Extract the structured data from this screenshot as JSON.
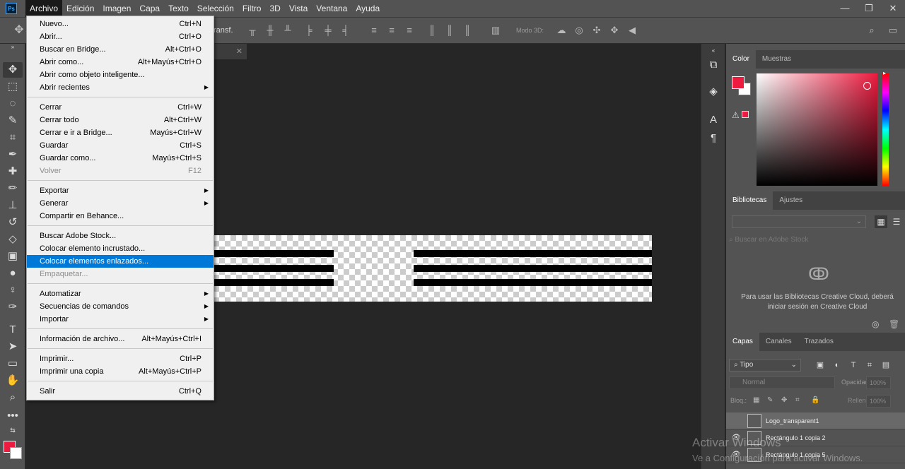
{
  "app": {
    "logo": "Ps",
    "window_controls": [
      "—",
      "❐",
      "✕"
    ]
  },
  "menubar": [
    "Archivo",
    "Edición",
    "Imagen",
    "Capa",
    "Texto",
    "Selección",
    "Filtro",
    "3D",
    "Vista",
    "Ventana",
    "Ayuda"
  ],
  "options_bar": {
    "transform_label": "ransf.",
    "mode_3d_label": "Modo 3D:"
  },
  "file_menu": [
    {
      "label": "Nuevo...",
      "shortcut": "Ctrl+N"
    },
    {
      "label": "Abrir...",
      "shortcut": "Ctrl+O"
    },
    {
      "label": "Buscar en Bridge...",
      "shortcut": "Alt+Ctrl+O"
    },
    {
      "label": "Abrir como...",
      "shortcut": "Alt+Mayús+Ctrl+O"
    },
    {
      "label": "Abrir como objeto inteligente...",
      "shortcut": ""
    },
    {
      "label": "Abrir recientes",
      "shortcut": "",
      "submenu": true
    },
    {
      "sep": true
    },
    {
      "label": "Cerrar",
      "shortcut": "Ctrl+W"
    },
    {
      "label": "Cerrar todo",
      "shortcut": "Alt+Ctrl+W"
    },
    {
      "label": "Cerrar e ir a Bridge...",
      "shortcut": "Mayús+Ctrl+W"
    },
    {
      "label": "Guardar",
      "shortcut": "Ctrl+S"
    },
    {
      "label": "Guardar como...",
      "shortcut": "Mayús+Ctrl+S"
    },
    {
      "label": "Volver",
      "shortcut": "F12",
      "disabled": true
    },
    {
      "sep": true
    },
    {
      "label": "Exportar",
      "shortcut": "",
      "submenu": true
    },
    {
      "label": "Generar",
      "shortcut": "",
      "submenu": true
    },
    {
      "label": "Compartir en Behance...",
      "shortcut": ""
    },
    {
      "sep": true
    },
    {
      "label": "Buscar Adobe Stock...",
      "shortcut": ""
    },
    {
      "label": "Colocar elemento incrustado...",
      "shortcut": ""
    },
    {
      "label": "Colocar elementos enlazados...",
      "shortcut": "",
      "highlighted": true
    },
    {
      "label": "Empaquetar...",
      "shortcut": "",
      "disabled": true
    },
    {
      "sep": true
    },
    {
      "label": "Automatizar",
      "shortcut": "",
      "submenu": true
    },
    {
      "label": "Secuencias de comandos",
      "shortcut": "",
      "submenu": true
    },
    {
      "label": "Importar",
      "shortcut": "",
      "submenu": true
    },
    {
      "sep": true
    },
    {
      "label": "Información de archivo...",
      "shortcut": "Alt+Mayús+Ctrl+I"
    },
    {
      "sep": true
    },
    {
      "label": "Imprimir...",
      "shortcut": "Ctrl+P"
    },
    {
      "label": "Imprimir una copia",
      "shortcut": "Alt+Mayús+Ctrl+P"
    },
    {
      "sep": true
    },
    {
      "label": "Salir",
      "shortcut": "Ctrl+Q"
    }
  ],
  "panels": {
    "color_tabs": [
      "Color",
      "Muestras"
    ],
    "library_tabs": [
      "Bibliotecas",
      "Ajustes"
    ],
    "library_search_placeholder": "Buscar en Adobe Stock",
    "library_message": "Para usar las Bibliotecas Creative Cloud, deberá iniciar sesión en Creative Cloud",
    "layers_tabs": [
      "Capas",
      "Canales",
      "Trazados"
    ],
    "layers_kind": "Tipo",
    "blend_mode": "Normal",
    "opacity_label": "Opacidad:",
    "opacity_value": "100%",
    "lock_label": "Bloq.:",
    "fill_label": "Relleno:",
    "fill_value": "100%",
    "layers": [
      {
        "name": "Logo_transparent1",
        "visible": false,
        "selected": true
      },
      {
        "name": "Rectángulo 1 copia 2",
        "visible": true,
        "selected": false
      },
      {
        "name": "Rectángulo 1 copia 5",
        "visible": true,
        "selected": false
      }
    ]
  },
  "colors": {
    "foreground": "#ed1b3f",
    "background": "#ffffff",
    "highlight": "#0078d7"
  },
  "watermark": {
    "title": "Activar Windows",
    "subtitle": "Ve a Configuración para activar Windows."
  }
}
